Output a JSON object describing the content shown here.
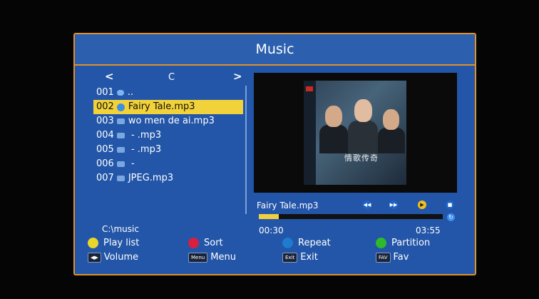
{
  "window": {
    "title": "Music"
  },
  "browser": {
    "nav_left": "<",
    "nav_right": ">",
    "drive": "C",
    "current_path": "C:\\music",
    "files": [
      {
        "num": "001",
        "icon": "folder-up-icon",
        "name": ".."
      },
      {
        "num": "002",
        "icon": "music-note-icon",
        "name": "Fairy Tale.mp3",
        "selected": true
      },
      {
        "num": "003",
        "icon": "mp3-file-icon",
        "name": "wo men de ai.mp3"
      },
      {
        "num": "004",
        "icon": "mp3-file-icon",
        "name": " - .mp3"
      },
      {
        "num": "005",
        "icon": "mp3-file-icon",
        "name": " - .mp3"
      },
      {
        "num": "006",
        "icon": "mp3-file-icon",
        "name": " -"
      },
      {
        "num": "007",
        "icon": "mp3-file-icon",
        "name": "JPEG.mp3"
      }
    ]
  },
  "player": {
    "now_playing": "Fairy Tale.mp3",
    "elapsed": "00:30",
    "total": "03:55",
    "progress": 0.11,
    "album_caption": "情歌传奇",
    "controls": [
      "previous-icon",
      "next-icon",
      "play-icon",
      "stop-icon"
    ]
  },
  "legend": {
    "play_list": "Play list",
    "sort": "Sort",
    "repeat": "Repeat",
    "partition": "Partition",
    "volume_key": "◀▶",
    "volume": "Volume",
    "menu_key": "Menu",
    "menu": "Menu",
    "exit_key": "Exit",
    "exit": "Exit",
    "fav_key": "FAV",
    "fav": "Fav"
  },
  "colors": {
    "panel": "#2356a8",
    "border": "#e0922a",
    "selection": "#f2d23a",
    "progress": "#f0d040"
  }
}
